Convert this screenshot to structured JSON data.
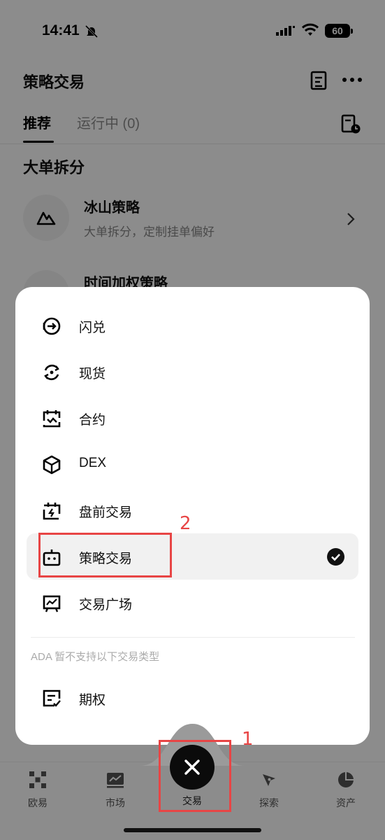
{
  "status_bar": {
    "time": "14:41",
    "battery": "60"
  },
  "header": {
    "title": "策略交易"
  },
  "tabs": [
    {
      "label": "推荐"
    },
    {
      "label": "运行中 (0)"
    }
  ],
  "section": {
    "title": "大单拆分"
  },
  "strategies": [
    {
      "name": "冰山策略",
      "desc": "大单拆分，定制挂单偏好"
    },
    {
      "name": "时间加权策略",
      "desc": ""
    }
  ],
  "trade_menu": {
    "items": [
      {
        "label": "闪兑",
        "icon": "flash-swap-icon"
      },
      {
        "label": "现货",
        "icon": "spot-icon"
      },
      {
        "label": "合约",
        "icon": "futures-icon"
      },
      {
        "label": "DEX",
        "icon": "dex-icon"
      },
      {
        "label": "盘前交易",
        "icon": "pre-market-icon"
      },
      {
        "label": "策略交易",
        "icon": "strategy-bot-icon",
        "selected": true
      },
      {
        "label": "交易广场",
        "icon": "trading-square-icon"
      }
    ],
    "unsupported_note": "ADA 暂不支持以下交易类型",
    "unsupported_items": [
      {
        "label": "期权",
        "icon": "options-icon"
      }
    ]
  },
  "bottom_nav": {
    "items": [
      {
        "label": "欧易",
        "icon": "okx-logo-icon"
      },
      {
        "label": "市场",
        "icon": "market-chart-icon"
      },
      {
        "label": "交易",
        "icon": "close-icon",
        "active": true
      },
      {
        "label": "探索",
        "icon": "compass-icon"
      },
      {
        "label": "资产",
        "icon": "pie-chart-icon"
      }
    ]
  },
  "annotations": {
    "box_1": "1",
    "box_2": "2"
  },
  "colors": {
    "annotation": "#e84545",
    "accent": "#0b0b0b",
    "overlay": "rgba(0,0,0,0.45)"
  }
}
